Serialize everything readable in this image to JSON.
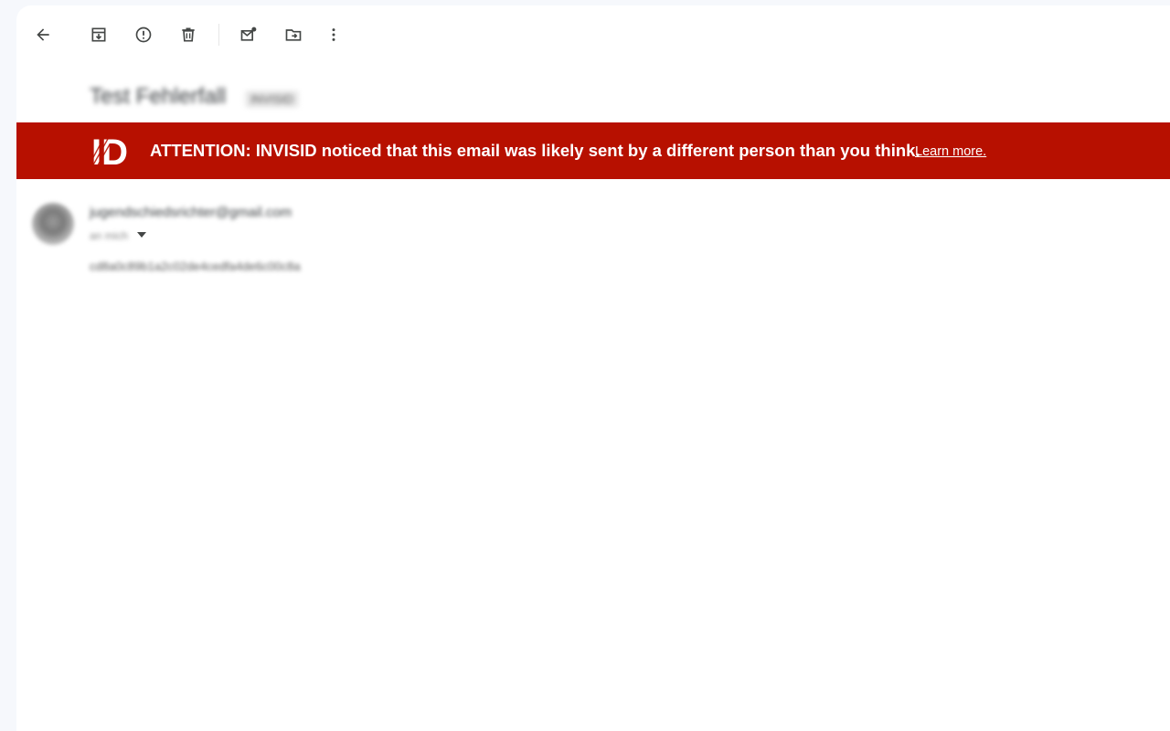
{
  "toolbar": {
    "buttons": [
      {
        "name": "back-arrow-icon",
        "interactable": true
      },
      {
        "name": "archive-icon",
        "interactable": true
      },
      {
        "name": "report-spam-icon",
        "interactable": true
      },
      {
        "name": "delete-icon",
        "interactable": true
      },
      {
        "name": "mark-unread-icon",
        "interactable": true
      },
      {
        "name": "move-to-icon",
        "interactable": true
      },
      {
        "name": "more-vert-icon",
        "interactable": true
      }
    ]
  },
  "email": {
    "subject": "Test Fehlerfall",
    "label": "INVISID",
    "sender": "jugendschiedsrichter@gmail.com",
    "recipient": "an mich",
    "body": "cd8a0c89b1a2c02de4cedfa4de6c00c8a"
  },
  "banner": {
    "logo_text": "ID",
    "message": "ATTENTION: INVISID noticed that this email was likely sent by a different person than you think.",
    "link": "Learn more."
  },
  "colors": {
    "banner_bg": "#b71000",
    "banner_text": "#ffffff",
    "page_bg": "#f6f8fc",
    "icon": "#444746"
  }
}
